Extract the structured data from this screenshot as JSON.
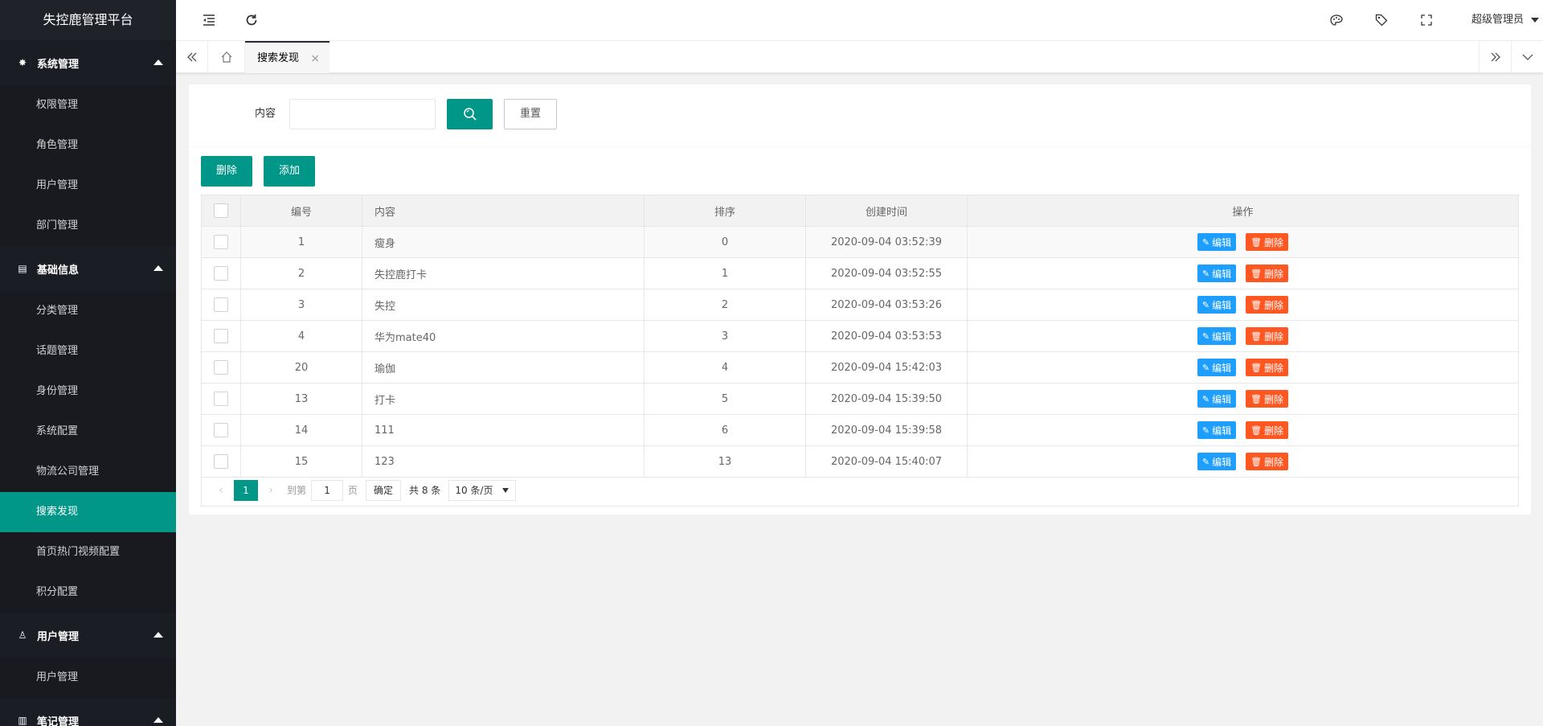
{
  "app": {
    "title": "失控鹿管理平台"
  },
  "sidebar": {
    "groups": [
      {
        "title": "系统管理",
        "icon": "gear-icon",
        "items": [
          "权限管理",
          "角色管理",
          "用户管理",
          "部门管理"
        ]
      },
      {
        "title": "基础信息",
        "icon": "document-icon",
        "items": [
          "分类管理",
          "话题管理",
          "身份管理",
          "系统配置",
          "物流公司管理",
          "搜索发现",
          "首页热门视频配置",
          "积分配置"
        ]
      },
      {
        "title": "用户管理",
        "icon": "user-icon",
        "items": [
          "用户管理"
        ]
      },
      {
        "title": "笔记管理",
        "icon": "notebook-icon",
        "items": []
      }
    ],
    "active_item": "搜索发现"
  },
  "header": {
    "user": "超级管理员",
    "icons": [
      "collapse-menu-icon",
      "refresh-icon",
      "theme-icon",
      "tag-icon",
      "fullscreen-icon"
    ]
  },
  "tabs": {
    "active_tab": "搜索发现"
  },
  "search": {
    "label": "内容",
    "value": "",
    "placeholder": "",
    "reset_label": "重置"
  },
  "toolbar": {
    "delete_label": "删除",
    "add_label": "添加"
  },
  "table": {
    "headers": {
      "id": "编号",
      "content": "内容",
      "order": "排序",
      "created": "创建时间",
      "actions": "操作"
    },
    "edit_label": "编辑",
    "delete_label": "删除",
    "rows": [
      {
        "id": "1",
        "content": "瘦身",
        "order": "0",
        "created": "2020-09-04 03:52:39"
      },
      {
        "id": "2",
        "content": "失控鹿打卡",
        "order": "1",
        "created": "2020-09-04 03:52:55"
      },
      {
        "id": "3",
        "content": "失控",
        "order": "2",
        "created": "2020-09-04 03:53:26"
      },
      {
        "id": "4",
        "content": "华为mate40",
        "order": "3",
        "created": "2020-09-04 03:53:53"
      },
      {
        "id": "20",
        "content": "瑜伽",
        "order": "4",
        "created": "2020-09-04 15:42:03"
      },
      {
        "id": "13",
        "content": "打卡",
        "order": "5",
        "created": "2020-09-04 15:39:50"
      },
      {
        "id": "14",
        "content": "111",
        "order": "6",
        "created": "2020-09-04 15:39:58"
      },
      {
        "id": "15",
        "content": "123",
        "order": "13",
        "created": "2020-09-04 15:40:07"
      }
    ]
  },
  "pager": {
    "current_page": "1",
    "goto_label": "到第",
    "goto_value": "1",
    "page_unit": "页",
    "confirm_label": "确定",
    "total_label": "共 8 条",
    "page_size_label": "10 条/页"
  },
  "colors": {
    "primary": "#009688",
    "sidebar_bg": "#20222a",
    "edit": "#1e9fff",
    "delete": "#ff5722"
  }
}
